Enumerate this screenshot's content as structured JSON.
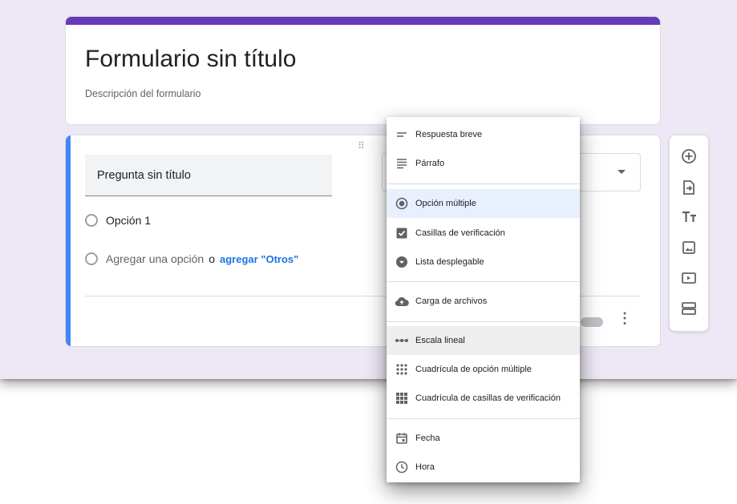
{
  "form": {
    "title": "Formulario sin título",
    "description": "Descripción del formulario"
  },
  "question": {
    "title": "Pregunta sin título",
    "option1": "Opción 1",
    "add_option": "Agregar una opción",
    "or_word": "o",
    "add_other": "agregar \"Otros\""
  },
  "menu": {
    "items": [
      {
        "label": "Respuesta breve",
        "icon": "short-answer-icon"
      },
      {
        "label": "Párrafo",
        "icon": "paragraph-icon"
      },
      {
        "label": "Opción múltiple",
        "icon": "radio-button-icon",
        "selected": true
      },
      {
        "label": "Casillas de verificación",
        "icon": "checkbox-icon"
      },
      {
        "label": "Lista desplegable",
        "icon": "dropdown-icon"
      },
      {
        "label": "Carga de archivos",
        "icon": "cloud-upload-icon"
      },
      {
        "label": "Escala lineal",
        "icon": "linear-scale-icon",
        "hovered": true
      },
      {
        "label": "Cuadrícula de opción múltiple",
        "icon": "grid-dots-icon"
      },
      {
        "label": "Cuadrícula de casillas de verificación",
        "icon": "grid-squares-icon"
      },
      {
        "label": "Fecha",
        "icon": "calendar-icon"
      },
      {
        "label": "Hora",
        "icon": "clock-icon"
      }
    ]
  },
  "toolbar": {
    "tools": [
      "add-question-icon",
      "import-questions-icon",
      "add-title-icon",
      "add-image-icon",
      "add-video-icon",
      "add-section-icon"
    ]
  },
  "colors": {
    "accent": "#673ab7",
    "question_bar": "#4285f4",
    "link": "#1a73e8",
    "canvas": "#ede7f6"
  }
}
